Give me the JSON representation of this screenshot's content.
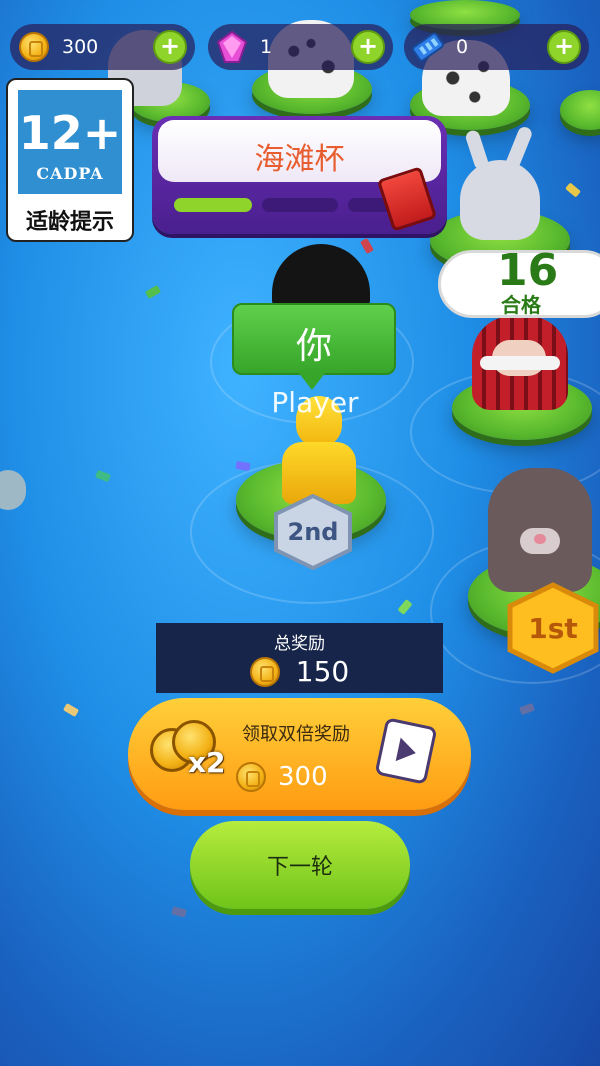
{
  "currency": {
    "coins": {
      "value": "300",
      "icon": "coin-icon"
    },
    "gems": {
      "value": "1",
      "icon": "gem-icon"
    },
    "tickets": {
      "value": "0",
      "icon": "ticket-icon"
    },
    "add_icon": "plus-icon"
  },
  "age_rating": {
    "number": "12+",
    "org": "CADPA",
    "tip": "适龄提示"
  },
  "stage": {
    "title": "海滩杯",
    "progress_segments_total": 3,
    "progress_segments_filled": 1
  },
  "qualified": {
    "count": "16",
    "label": "合格"
  },
  "player": {
    "tag": "你",
    "name": "Player",
    "rank": "2nd"
  },
  "rival": {
    "rank": "1st"
  },
  "rewards": {
    "total_label": "总奖励",
    "total_amount": "150",
    "double_label": "领取双倍奖励",
    "double_multiplier": "x2",
    "double_amount": "300"
  },
  "next_button": "下一轮",
  "colors": {
    "water": "#1f8ee6",
    "banner_purple": "#5a2aa0",
    "qualified_green": "#2a7b17",
    "double_orange": "#ff9c12",
    "next_green": "#8fd42a"
  }
}
